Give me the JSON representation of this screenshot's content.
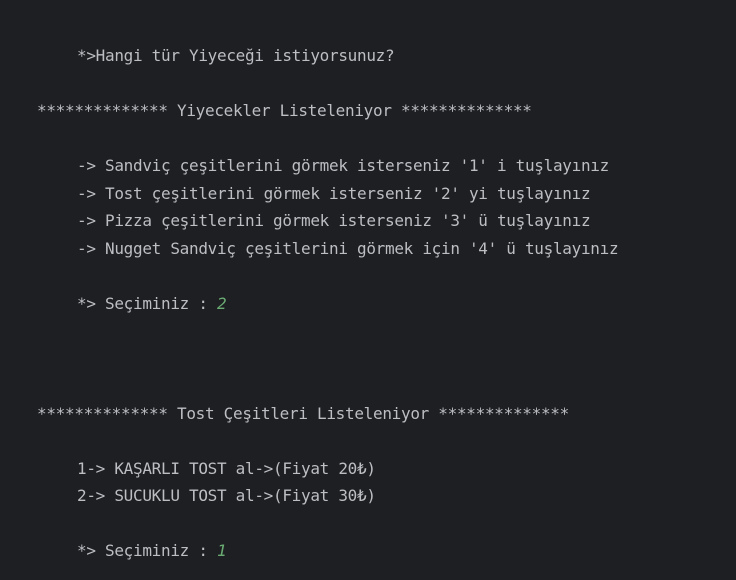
{
  "console": {
    "question": "*>Hangi tür Yiyeceği istiyorsunuz?",
    "food_list_header": "************** Yiyecekler Listeleniyor **************",
    "options": [
      "-> Sandviç çeşitlerini görmek isterseniz '1' i tuşlayınız",
      "-> Tost çeşitlerini görmek isterseniz '2' yi tuşlayınız",
      "-> Pizza çeşitlerini görmek isterseniz '3' ü tuşlayınız",
      "-> Nugget Sandviç çeşitlerini görmek için '4' ü tuşlayınız"
    ],
    "selection_prompt_1": "*> Seçiminiz : ",
    "selection_value_1": "2",
    "toast_list_header": "************** Tost Çeşitleri Listeleniyor **************",
    "toast_items": [
      "1-> KAŞARLI TOST al->(Fiyat 20₺)",
      "2-> SUCUKLU TOST al->(Fiyat 30₺)"
    ],
    "selection_prompt_2": "*> Seçiminiz : ",
    "selection_value_2": "1",
    "colors": {
      "background": "#1e1f22",
      "text": "#bcbec4",
      "user_input": "#6aab73"
    }
  }
}
